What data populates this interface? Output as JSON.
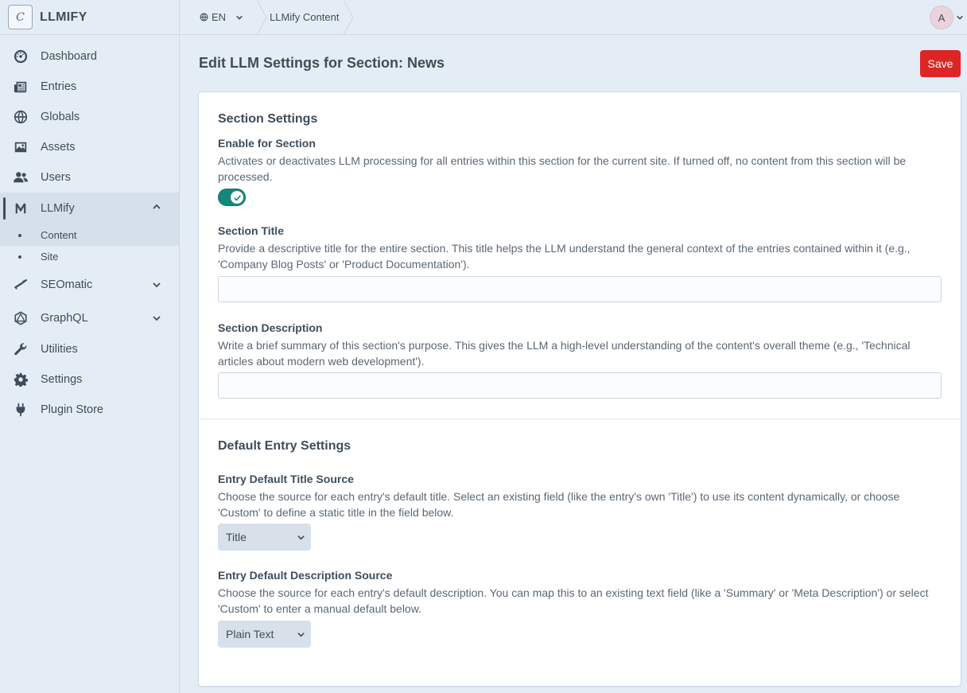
{
  "brand": {
    "logo_letter": "C",
    "name": "LLMIFY"
  },
  "sidebar": {
    "items": [
      {
        "label": "Dashboard",
        "icon": "gauge-icon"
      },
      {
        "label": "Entries",
        "icon": "newspaper-icon"
      },
      {
        "label": "Globals",
        "icon": "globe-icon"
      },
      {
        "label": "Assets",
        "icon": "image-icon"
      },
      {
        "label": "Users",
        "icon": "users-icon"
      },
      {
        "label": "LLMify",
        "icon": "llmify-icon",
        "expanded": true
      },
      {
        "label": "SEOmatic",
        "icon": "seomatic-icon"
      },
      {
        "label": "GraphQL",
        "icon": "graphql-icon"
      },
      {
        "label": "Utilities",
        "icon": "wrench-icon"
      },
      {
        "label": "Settings",
        "icon": "gear-icon"
      },
      {
        "label": "Plugin Store",
        "icon": "plug-icon"
      }
    ],
    "llmify_sub": [
      {
        "label": "Content",
        "current": true
      },
      {
        "label": "Site",
        "current": false
      }
    ]
  },
  "topbar": {
    "language": "EN",
    "breadcrumb": "LLMify Content",
    "avatar_letter": "A"
  },
  "page": {
    "title": "Edit LLM Settings for Section: News",
    "save_label": "Save"
  },
  "section_settings": {
    "heading": "Section Settings",
    "enable": {
      "label": "Enable for Section",
      "help": "Activates or deactivates LLM processing for all entries within this section for the current site. If turned off, no content from this section will be processed.",
      "value": true
    },
    "title": {
      "label": "Section Title",
      "help": "Provide a descriptive title for the entire section. This title helps the LLM understand the general context of the entries contained within it (e.g., 'Company Blog Posts' or 'Product Documentation').",
      "value": ""
    },
    "description": {
      "label": "Section Description",
      "help": "Write a brief summary of this section's purpose. This gives the LLM a high-level understanding of the content's overall theme (e.g., 'Technical articles about modern web development').",
      "value": ""
    }
  },
  "default_entry_settings": {
    "heading": "Default Entry Settings",
    "title_source": {
      "label": "Entry Default Title Source",
      "help": "Choose the source for each entry's default title. Select an existing field (like the entry's own 'Title') to use its content dynamically, or choose 'Custom' to define a static title in the field below.",
      "selected": "Title"
    },
    "description_source": {
      "label": "Entry Default Description Source",
      "help": "Choose the source for each entry's default description. You can map this to an existing text field (like a 'Summary' or 'Meta Description') or select 'Custom' to enter a manual default below.",
      "selected": "Plain Text"
    }
  },
  "colors": {
    "save_button": "#dc2626",
    "toggle_on": "#13897d",
    "background": "#e4edf6"
  }
}
